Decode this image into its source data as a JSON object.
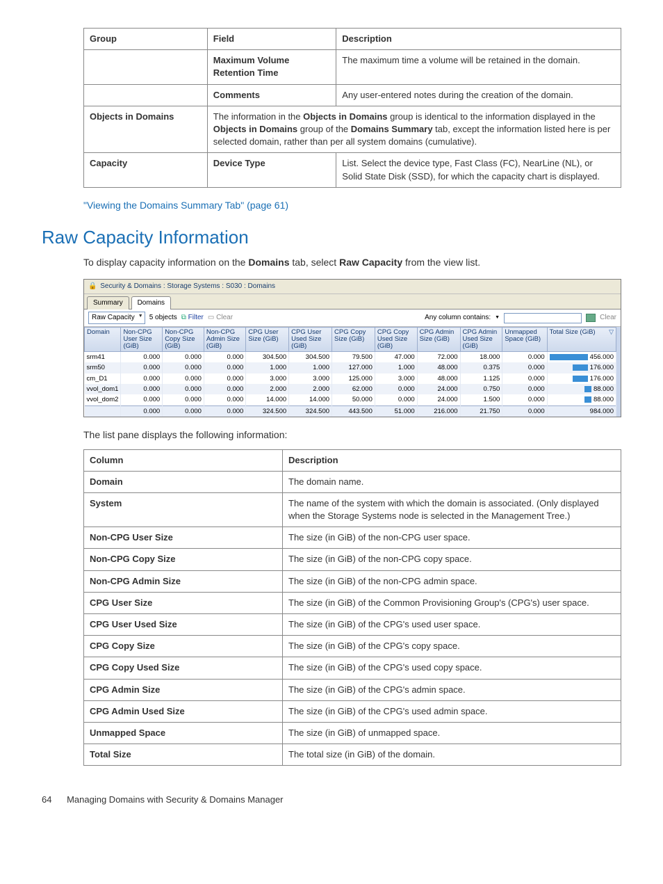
{
  "table1": {
    "headers": [
      "Group",
      "Field",
      "Description"
    ],
    "rows": [
      {
        "group": "",
        "field": "Maximum Volume Retention Time",
        "desc": "The maximum time a volume will be retained in the domain."
      },
      {
        "group": "",
        "field": "Comments",
        "desc": "Any user-entered notes during the creation of the domain."
      },
      {
        "group": "Objects in Domains",
        "field_span": true,
        "desc_html": "The information in the <b>Objects in Domains</b> group is identical to the information displayed in the <b>Objects in Domains</b> group of the <b>Domains Summary</b> tab, except the information listed here is per selected domain, rather than per all system domains (cumulative)."
      },
      {
        "group": "Capacity",
        "field": "Device Type",
        "desc": "List. Select the device type, Fast Class (FC), NearLine (NL), or Solid State Disk (SSD), for which the capacity chart is displayed."
      }
    ]
  },
  "link1": "\"Viewing the Domains Summary Tab\" (page 61)",
  "section_title": "Raw Capacity Information",
  "intro_html": "To display capacity information on the <b>Domains</b> tab, select <b>Raw Capacity</b> from the view list.",
  "screenshot": {
    "window_title": "Security & Domains : Storage Systems : S030 : Domains",
    "tabs": [
      "Summary",
      "Domains"
    ],
    "active_tab": 1,
    "toolbar": {
      "view": "Raw Capacity",
      "count": "5 objects",
      "filter": "Filter",
      "clear": "Clear",
      "search_label": "Any column contains:",
      "clear2": "Clear"
    },
    "columns": [
      "Domain",
      "Non-CPG User Size (GiB)",
      "Non-CPG Copy Size (GiB)",
      "Non-CPG Admin Size (GiB)",
      "CPG User Size (GiB)",
      "CPG User Used Size (GiB)",
      "CPG Copy Size (GiB)",
      "CPG Copy Used Size (GiB)",
      "CPG Admin Size (GiB)",
      "CPG Admin Used Size (GiB)",
      "Unmapped Space (GiB)",
      "Total Size (GiB)"
    ],
    "rows": [
      {
        "name": "srm41",
        "v": [
          "0.000",
          "0.000",
          "0.000",
          "304.500",
          "304.500",
          "79.500",
          "47.000",
          "72.000",
          "18.000",
          "0.000"
        ],
        "total": "456.000",
        "bar": 100
      },
      {
        "name": "srm50",
        "v": [
          "0.000",
          "0.000",
          "0.000",
          "1.000",
          "1.000",
          "127.000",
          "1.000",
          "48.000",
          "0.375",
          "0.000"
        ],
        "total": "176.000",
        "bar": 39
      },
      {
        "name": "cm_D1",
        "v": [
          "0.000",
          "0.000",
          "0.000",
          "3.000",
          "3.000",
          "125.000",
          "3.000",
          "48.000",
          "1.125",
          "0.000"
        ],
        "total": "176.000",
        "bar": 39
      },
      {
        "name": "vvol_dom1",
        "v": [
          "0.000",
          "0.000",
          "0.000",
          "2.000",
          "2.000",
          "62.000",
          "0.000",
          "24.000",
          "0.750",
          "0.000"
        ],
        "total": "88.000",
        "bar": 19
      },
      {
        "name": "vvol_dom2",
        "v": [
          "0.000",
          "0.000",
          "0.000",
          "14.000",
          "14.000",
          "50.000",
          "0.000",
          "24.000",
          "1.500",
          "0.000"
        ],
        "total": "88.000",
        "bar": 19
      }
    ],
    "totals": {
      "v": [
        "0.000",
        "0.000",
        "0.000",
        "324.500",
        "324.500",
        "443.500",
        "51.000",
        "216.000",
        "21.750",
        "0.000"
      ],
      "total": "984.000"
    }
  },
  "list_intro": "The list pane displays the following information:",
  "col_table": {
    "headers": [
      "Column",
      "Description"
    ],
    "rows": [
      [
        "Domain",
        "The domain name."
      ],
      [
        "System",
        "The name of the system with which the domain is associated. (Only displayed when the Storage Systems node is selected in the Management Tree.)"
      ],
      [
        "Non-CPG User Size",
        "The size (in GiB) of the non-CPG user space."
      ],
      [
        "Non-CPG Copy Size",
        "The size (in GiB) of the non-CPG copy space."
      ],
      [
        "Non-CPG Admin Size",
        "The size (in GiB) of the non-CPG admin space."
      ],
      [
        "CPG User Size",
        "The size (in GiB) of the Common Provisioning Group's (CPG's) user space."
      ],
      [
        "CPG User Used Size",
        "The size (in GiB) of the CPG's used user space."
      ],
      [
        "CPG Copy Size",
        "The size (in GiB) of the CPG's copy space."
      ],
      [
        "CPG Copy Used Size",
        "The size (in GiB) of the CPG's used copy space."
      ],
      [
        "CPG Admin Size",
        "The size (in GiB) of the CPG's admin space."
      ],
      [
        "CPG Admin Used Size",
        "The size (in GiB) of the CPG's used admin space."
      ],
      [
        "Unmapped Space",
        "The size (in GiB) of unmapped space."
      ],
      [
        "Total Size",
        "The total size (in GiB) of the domain."
      ]
    ]
  },
  "footer": {
    "page": "64",
    "title": "Managing Domains with Security & Domains Manager"
  }
}
